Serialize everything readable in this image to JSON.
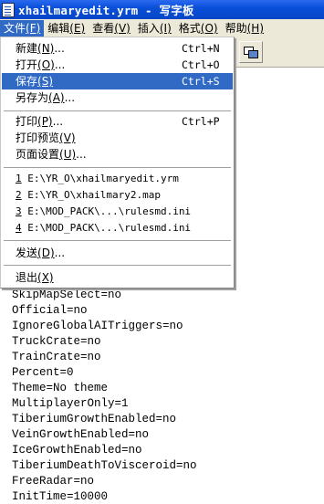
{
  "window": {
    "title": "xhailmaryedit.yrm - 写字板"
  },
  "menubar": {
    "items": [
      {
        "label": "文件",
        "mnemonic": "(F)"
      },
      {
        "label": "编辑",
        "mnemonic": "(E)"
      },
      {
        "label": "查看",
        "mnemonic": "(V)"
      },
      {
        "label": "插入",
        "mnemonic": "(I)"
      },
      {
        "label": "格式",
        "mnemonic": "(O)"
      },
      {
        "label": "帮助",
        "mnemonic": "(H)"
      }
    ],
    "active_index": 0
  },
  "toolbar": {
    "insert_object_icon": "insert-object-icon"
  },
  "file_menu": {
    "new": {
      "label": "新建",
      "mnemonic": "(N)",
      "suffix": "...",
      "shortcut": "Ctrl+N"
    },
    "open": {
      "label": "打开",
      "mnemonic": "(O)",
      "suffix": "...",
      "shortcut": "Ctrl+O"
    },
    "save": {
      "label": "保存",
      "mnemonic": "(S)",
      "suffix": "",
      "shortcut": "Ctrl+S"
    },
    "save_as": {
      "label": "另存为",
      "mnemonic": "(A)",
      "suffix": "..."
    },
    "print": {
      "label": "打印",
      "mnemonic": "(P)",
      "suffix": "...",
      "shortcut": "Ctrl+P"
    },
    "print_preview": {
      "label": "打印预览",
      "mnemonic": "(V)",
      "suffix": ""
    },
    "page_setup": {
      "label": "页面设置",
      "mnemonic": "(U)",
      "suffix": "..."
    },
    "recent": [
      {
        "num": "1",
        "path": "E:\\YR_O\\xhailmaryedit.yrm"
      },
      {
        "num": "2",
        "path": "E:\\YR_O\\xhailmary2.map"
      },
      {
        "num": "3",
        "path": "E:\\MOD_PACK\\...\\rulesmd.ini"
      },
      {
        "num": "4",
        "path": "E:\\MOD_PACK\\...\\rulesmd.ini"
      }
    ],
    "send": {
      "label": "发送",
      "mnemonic": "(D)",
      "suffix": "..."
    },
    "exit": {
      "label": "退出",
      "mnemonic": "(X)",
      "suffix": ""
    }
  },
  "document": {
    "lines": [
      "SkipMapSelect=no",
      "Official=no",
      "IgnoreGlobalAITriggers=no",
      "TruckCrate=no",
      "TrainCrate=no",
      "Percent=0",
      "Theme=No theme",
      "MultiplayerOnly=1",
      "TiberiumGrowthEnabled=no",
      "VeinGrowthEnabled=no",
      "IceGrowthEnabled=no",
      "TiberiumDeathToVisceroid=no",
      "FreeRadar=no",
      "InitTime=10000"
    ]
  },
  "colors": {
    "titlebar": "#0a4fd8",
    "highlight": "#316ac5",
    "menubar": "#ece9d8"
  }
}
